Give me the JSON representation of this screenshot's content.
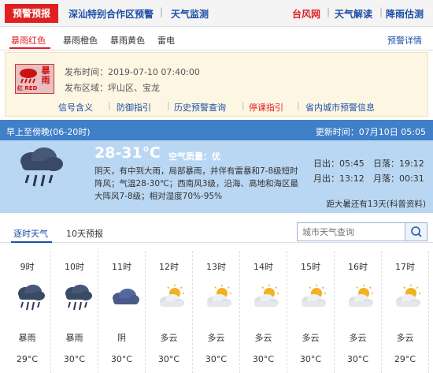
{
  "topnav": {
    "alert_button": "预警预报",
    "items": [
      "深汕特别合作区预警",
      "天气监测",
      "台风网",
      "天气解读",
      "降雨估测"
    ]
  },
  "tabs": {
    "items": [
      "暴雨红色",
      "暴雨橙色",
      "暴雨黄色",
      "雷电"
    ],
    "active_index": 0,
    "right_link": "预警详情"
  },
  "warning": {
    "icon_char_top": "暴",
    "icon_char_bottom": "雨",
    "icon_bottom_text": "红 RED",
    "publish_time_label": "发布时间：",
    "publish_time": "2019-07-10 07:40:00",
    "publish_area_label": "发布区域：",
    "publish_area": "坪山区、宝龙",
    "links": [
      "信号含义",
      "防御指引",
      "历史预警查询",
      "停课指引",
      "省内城市预警信息"
    ]
  },
  "forecast": {
    "period": "早上至傍晚(06-20时)",
    "update": "更新时间：07月10日 05:05",
    "temp_range": "28-31℃",
    "aqi_label": "空气质量：",
    "aqi_value": "优",
    "description": "阴天，有中到大雨，局部暴雨，并伴有雷暴和7-8级短时阵风；气温28-30℃；西南风3级，沿海、高地和海区最大阵风7-8级；相对湿度70%-95%",
    "sunrise_label": "日出：",
    "sunrise": "05:45",
    "sunset_label": "日落：",
    "sunset": "19:12",
    "moonrise_label": "月出：",
    "moonrise": "13:12",
    "moonset_label": "月落：",
    "moonset": "00:31",
    "countdown": "距大暑还有13天(科普资料)"
  },
  "hourly_tabs": {
    "items": [
      "逐时天气",
      "10天预报"
    ],
    "active_index": 0,
    "search_placeholder": "城市天气查询"
  },
  "hours": [
    {
      "time": "9时",
      "cond": "暴雨",
      "temp": "29°C",
      "icon": "heavy-rain-icon"
    },
    {
      "time": "10时",
      "cond": "暴雨",
      "temp": "30°C",
      "icon": "heavy-rain-icon"
    },
    {
      "time": "11时",
      "cond": "阴",
      "temp": "30°C",
      "icon": "overcast-icon"
    },
    {
      "time": "12时",
      "cond": "多云",
      "temp": "30°C",
      "icon": "partly-cloudy-icon"
    },
    {
      "time": "13时",
      "cond": "多云",
      "temp": "30°C",
      "icon": "partly-cloudy-icon"
    },
    {
      "time": "14时",
      "cond": "多云",
      "temp": "30°C",
      "icon": "partly-cloudy-icon"
    },
    {
      "time": "15时",
      "cond": "多云",
      "temp": "30°C",
      "icon": "partly-cloudy-icon"
    },
    {
      "time": "16时",
      "cond": "多云",
      "temp": "30°C",
      "icon": "partly-cloudy-icon"
    },
    {
      "time": "17时",
      "cond": "多云",
      "temp": "29°C",
      "icon": "partly-cloudy-icon"
    }
  ],
  "colors": {
    "alert_red": "#e02020",
    "link_blue": "#1d4fa5",
    "panel_blue": "#b9d7f3",
    "panel_header_blue": "#3f80c8"
  }
}
